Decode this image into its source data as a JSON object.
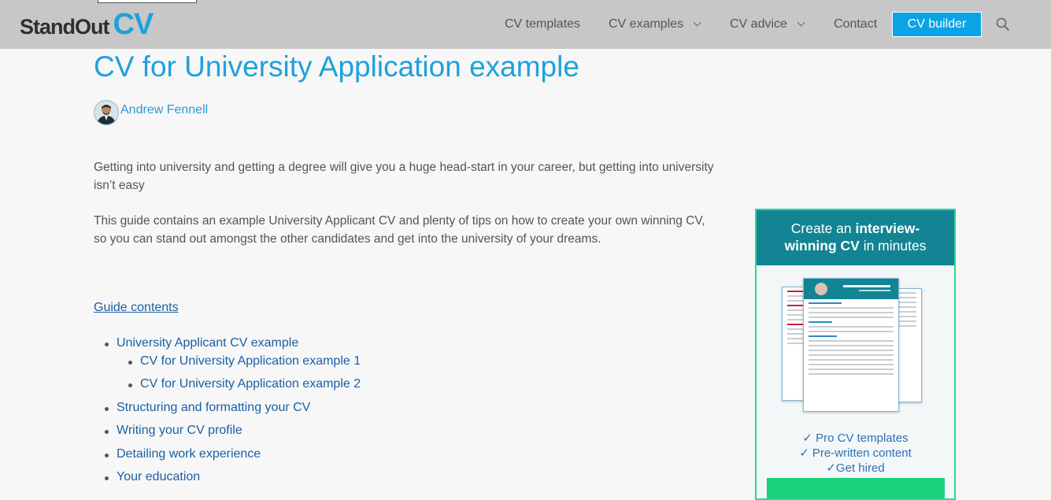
{
  "header": {
    "logo_word": "StandOut",
    "logo_cv": "CV",
    "nav": [
      {
        "label": "CV templates"
      },
      {
        "label": "CV examples"
      },
      {
        "label": "CV advice"
      },
      {
        "label": "Contact"
      }
    ],
    "cta_label": "CV builder",
    "accent_color": "#0aa3e6"
  },
  "article": {
    "title": "CV for University Application example",
    "author": "Andrew Fennell",
    "intro": [
      "Getting into university and getting a degree will give you a huge head-start in your career, but getting into university isn’t easy",
      "This guide contains an example University Applicant CV and plenty of tips on how to create your own winning CV, so you can stand out amongst the other candidates and get into the university of your dreams."
    ],
    "contents_title": "Guide contents",
    "toc": [
      {
        "label": "University Applicant CV example"
      },
      {
        "label": "CV for University Application example 1"
      },
      {
        "label": "CV for University Application example 2"
      },
      {
        "label": "Structuring and formatting your CV"
      },
      {
        "label": "Writing your CV profile"
      },
      {
        "label": "Detailing work experience"
      },
      {
        "label": "Your education"
      }
    ]
  },
  "ad": {
    "line1_pre": "Create an ",
    "line1_bold": "interview-",
    "line2_bold": "winning CV",
    "line2_post": " in minutes",
    "features": [
      "✓ Pro CV templates",
      "✓ Pre-written content",
      "✓Get hired"
    ],
    "header_color": "#128494",
    "border_color": "#2bd69a"
  }
}
